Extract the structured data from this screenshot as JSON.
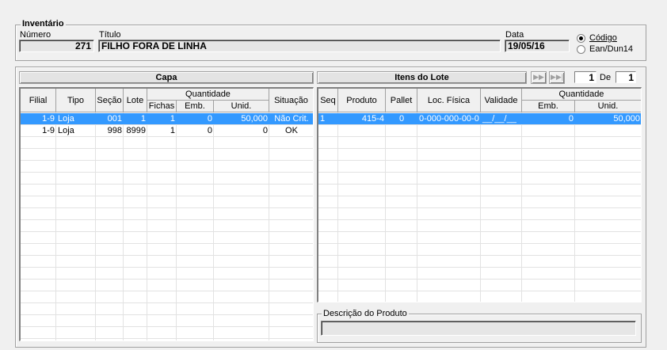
{
  "inventario": {
    "legend": "Inventário",
    "numero_label": "Número",
    "numero_value": "271",
    "titulo_label": "Título",
    "titulo_value": "FILHO FORA DE LINHA",
    "data_label": "Data",
    "data_value": "19/05/16",
    "radio_codigo": "Código",
    "radio_ean": "Ean/Dun14",
    "selected_radio": "codigo"
  },
  "capa": {
    "title": "Capa",
    "headers": {
      "filial": "Filial",
      "tipo": "Tipo",
      "secao": "Seção",
      "lote": "Lote",
      "quantidade": "Quantidade",
      "fichas": "Fichas",
      "emb": "Emb.",
      "unid": "Unid.",
      "situacao": "Situação"
    },
    "rows": [
      {
        "filial": "1-9",
        "tipo": "Loja",
        "secao": "001",
        "lote": "1",
        "fichas": "1",
        "emb": "0",
        "unid": "50,000",
        "situacao": "Não Crit.",
        "selected": true
      },
      {
        "filial": "1-9",
        "tipo": "Loja",
        "secao": "998",
        "lote": "8999",
        "fichas": "1",
        "emb": "0",
        "unid": "0",
        "situacao": "OK",
        "selected": false
      }
    ]
  },
  "itens": {
    "title": "Itens do Lote",
    "page_current": "1",
    "page_sep": "De",
    "page_total": "1",
    "headers": {
      "seq": "Seq",
      "produto": "Produto",
      "pallet": "Pallet",
      "loc": "Loc. Física",
      "validade": "Validade",
      "quantidade": "Quantidade",
      "emb": "Emb.",
      "unid": "Unid."
    },
    "rows": [
      {
        "seq": "1",
        "produto": "415-4",
        "pallet": "0",
        "loc": "0-000-000-00-0",
        "validade": "__/__/__",
        "emb": "0",
        "unid": "50,000",
        "selected": true
      }
    ]
  },
  "descricao": {
    "label": "Descrição do Produto",
    "value": ""
  }
}
